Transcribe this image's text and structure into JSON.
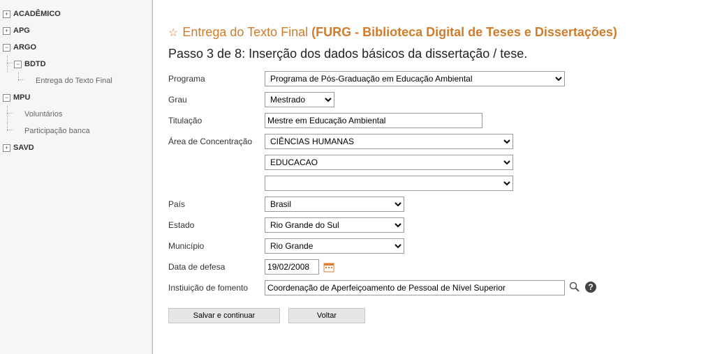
{
  "sidebar": {
    "items": [
      {
        "label": "ACADÊMICO",
        "toggle": "+"
      },
      {
        "label": "APG",
        "toggle": "+"
      },
      {
        "label": "ARGO",
        "toggle": "−",
        "children": [
          {
            "label": "BDTD",
            "toggle": "−",
            "children": [
              {
                "label": "Entrega do Texto Final"
              }
            ]
          }
        ]
      },
      {
        "label": "MPU",
        "toggle": "−",
        "children": [
          {
            "label": "Voluntários"
          },
          {
            "label": "Participação banca"
          }
        ]
      },
      {
        "label": "SAVD",
        "toggle": "+"
      }
    ]
  },
  "header": {
    "star": "☆",
    "title_prefix": "Entrega do Texto Final ",
    "title_paren": "(FURG - Biblioteca Digital de Teses e Dissertações)",
    "step": "Passo 3 de 8: Inserção dos dados básicos da dissertação / tese."
  },
  "form": {
    "programa_label": "Programa",
    "programa_value": "Programa de Pós-Graduação em Educação Ambiental",
    "grau_label": "Grau",
    "grau_value": "Mestrado",
    "titulacao_label": "Titulação",
    "titulacao_value": "Mestre em Educação Ambiental",
    "area_label": "Área de Concentração",
    "area1_value": "CIÊNCIAS HUMANAS",
    "area2_value": "EDUCACAO",
    "area3_value": "",
    "pais_label": "País",
    "pais_value": "Brasil",
    "estado_label": "Estado",
    "estado_value": "Rio Grande do Sul",
    "municipio_label": "Município",
    "municipio_value": "Rio Grande",
    "data_label": "Data de defesa",
    "data_value": "19/02/2008",
    "fomento_label": "Instiuição de fomento",
    "fomento_value": "Coordenação de Aperfeiçoamento de Pessoal de Nível Superior"
  },
  "buttons": {
    "save": "Salvar e continuar",
    "back": "Voltar"
  }
}
